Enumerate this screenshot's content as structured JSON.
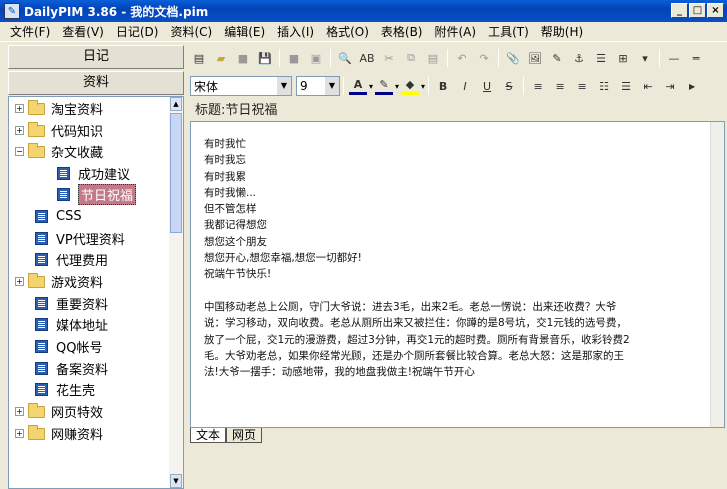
{
  "window": {
    "title": "DailyPIM 3.86 - 我的文档.pim",
    "app_icon": "app-logo-icon"
  },
  "menu": [
    "文件(F)",
    "查看(V)",
    "日记(D)",
    "资料(C)",
    "编辑(E)",
    "插入(I)",
    "格式(O)",
    "表格(B)",
    "附件(A)",
    "工具(T)",
    "帮助(H)"
  ],
  "left": {
    "diary_btn": "日记",
    "data_btn": "资料",
    "tree": [
      {
        "label": "淘宝资料",
        "type": "folder",
        "expand": "+",
        "level": 0
      },
      {
        "label": "代码知识",
        "type": "folder",
        "expand": "+",
        "level": 0
      },
      {
        "label": "杂文收藏",
        "type": "folder",
        "expand": "−",
        "level": 0
      },
      {
        "label": "成功建议",
        "type": "doc",
        "level": 1
      },
      {
        "label": "节日祝福",
        "type": "doc",
        "level": 1,
        "selected": true
      },
      {
        "label": "CSS",
        "type": "doc",
        "level": 0
      },
      {
        "label": "VP代理资料",
        "type": "doc",
        "level": 0
      },
      {
        "label": "代理费用",
        "type": "doc",
        "level": 0
      },
      {
        "label": "游戏资料",
        "type": "folder",
        "expand": "+",
        "level": 0
      },
      {
        "label": "重要资料",
        "type": "doc",
        "level": 0
      },
      {
        "label": "媒体地址",
        "type": "doc",
        "level": 0
      },
      {
        "label": "QQ帐号",
        "type": "doc",
        "level": 0
      },
      {
        "label": "备案资料",
        "type": "doc",
        "level": 0
      },
      {
        "label": "花生壳",
        "type": "doc",
        "level": 0
      },
      {
        "label": "网页特效",
        "type": "folder",
        "expand": "+",
        "level": 0
      },
      {
        "label": "网赚资料",
        "type": "folder",
        "expand": "+",
        "level": 0
      }
    ]
  },
  "format": {
    "font": "宋体",
    "size": "9"
  },
  "note": {
    "subject": "标题:节日祝福",
    "lines": [
      "有时我忙",
      "有时我忘",
      "有时我累",
      "有时我懒...",
      "但不管怎样",
      "我都记得想您",
      "想您这个朋友",
      "想您开心,想您幸福,想您一切都好!",
      "祝端午节快乐!",
      "",
      "中国移动老总上公厕，守门大爷说：进去3毛，出来2毛。老总一愣说：出来还收费？大爷",
      "说：学习移动，双向收费。老总从厕所出来又被拦住：你蹲的是8号坑，交1元钱的选号费，",
      "放了一个屁，交1元的漫游费，超过3分钟，再交1元的超时费。厕所有背景音乐，收彩铃费2",
      "毛。大爷劝老总，如果你经常光顾，还是办个厕所套餐比较合算。老总大怒：这是那家的王",
      "法!大爷一摆手：动感地带，我的地盘我做主!祝端午节开心"
    ]
  },
  "tabs": [
    "文本",
    "网页"
  ]
}
